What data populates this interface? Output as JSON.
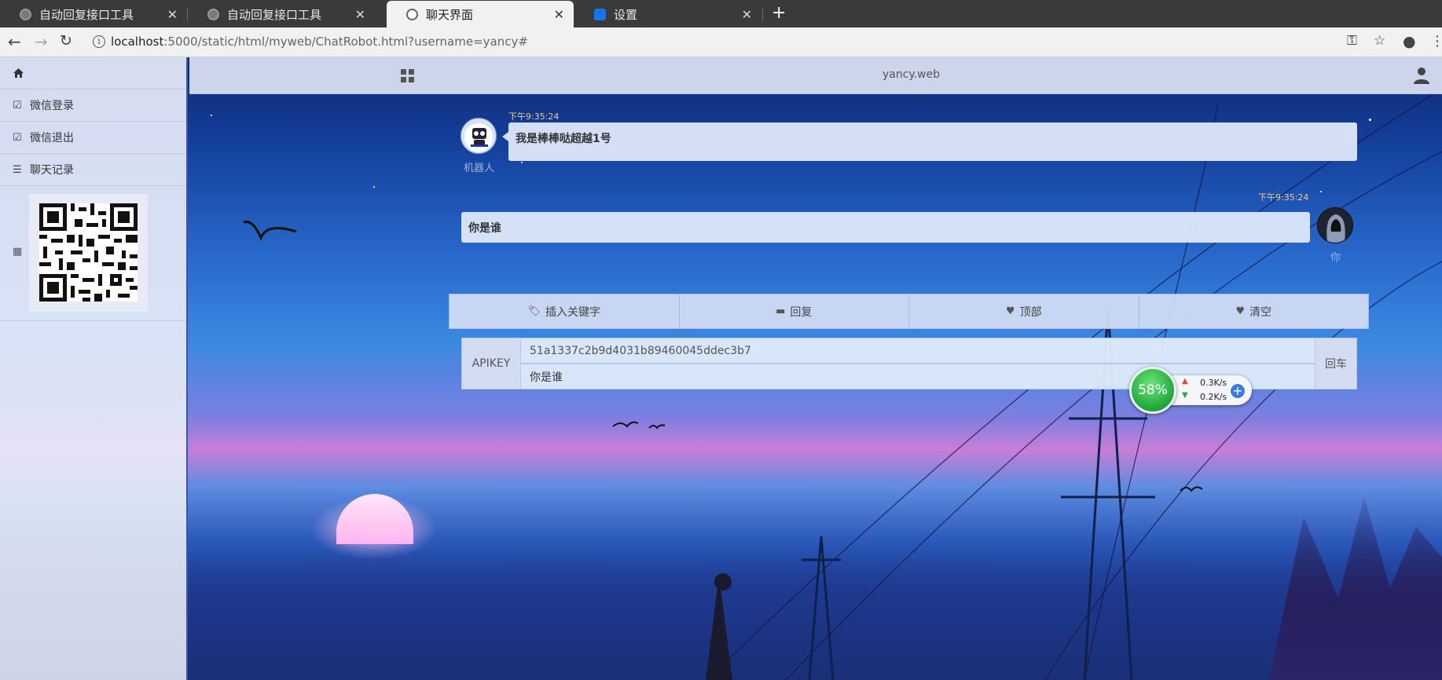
{
  "browser": {
    "tabs": [
      {
        "label": "自动回复接口工具",
        "active": false
      },
      {
        "label": "自动回复接口工具",
        "active": false
      },
      {
        "label": "聊天界面",
        "active": true
      },
      {
        "label": "设置",
        "active": false
      }
    ],
    "new_tab": "+",
    "url_host": "localhost",
    "url_rest": ":5000/static/html/myweb/ChatRobot.html?username=yancy#"
  },
  "sidebar": {
    "items": [
      {
        "label": "微信登录",
        "icon": "edit-icon"
      },
      {
        "label": "微信退出",
        "icon": "edit-icon"
      },
      {
        "label": "聊天记录",
        "icon": "list-icon"
      }
    ]
  },
  "navbar": {
    "brand": "yancy.web"
  },
  "chat": {
    "messages": [
      {
        "side": "left",
        "time": "下午9:35:24",
        "text": "我是棒棒哒超越1号",
        "sender": "机器人"
      },
      {
        "side": "right",
        "time": "下午9:35:24",
        "text": "你是谁",
        "sender": "你"
      }
    ]
  },
  "actions": [
    {
      "label": "插入关键字",
      "icon": "tags-icon"
    },
    {
      "label": "回复",
      "icon": "comment-icon"
    },
    {
      "label": "顶部",
      "icon": "heart-icon"
    },
    {
      "label": "清空",
      "icon": "heart-icon"
    }
  ],
  "input": {
    "addon": "APIKEY",
    "apikey_value": "51a1337c2b9d4031b89460045ddec3b7",
    "message_value": "你是谁",
    "enter_label": "回车"
  },
  "speed_widget": {
    "percent": "58%",
    "upload": "0.3K/s",
    "download": "0.2K/s"
  },
  "colors": {
    "accent_blue": "#3a56b0",
    "bubble": "#dee8fa",
    "timestamp": "#f0c890"
  }
}
